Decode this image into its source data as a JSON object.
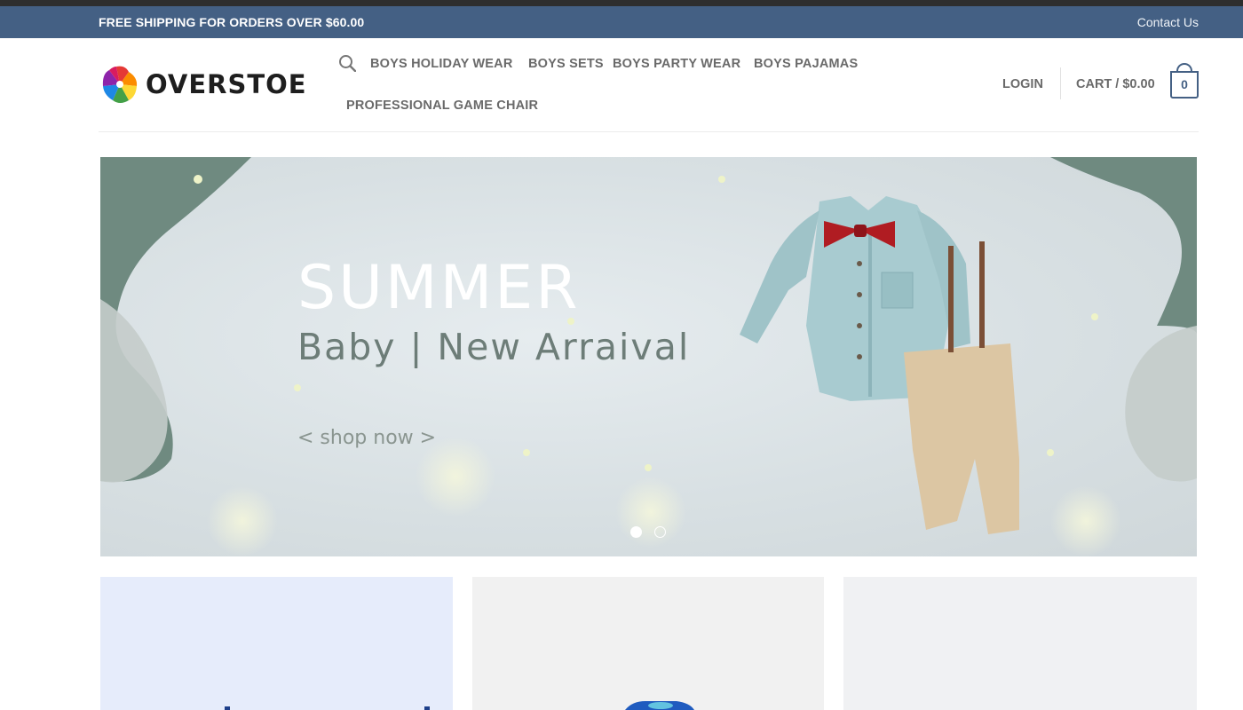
{
  "topbar": {
    "promo": "FREE SHIPPING FOR ORDERS OVER $60.00",
    "contact": "Contact Us"
  },
  "logo": {
    "text": "OVERSTOE"
  },
  "nav": {
    "items": [
      {
        "label": "BOYS HOLIDAY WEAR"
      },
      {
        "label": "BOYS SETS"
      },
      {
        "label": "BOYS PARTY WEAR"
      },
      {
        "label": "BOYS PAJAMAS"
      },
      {
        "label": "PROFESSIONAL GAME CHAIR"
      }
    ]
  },
  "account": {
    "login": "LOGIN",
    "cart": "CART / $0.00",
    "cart_count": "0"
  },
  "hero": {
    "title": "SUMMER",
    "subtitle": "Baby | New Arraival",
    "cta": "< shop now >",
    "slide_count": 2,
    "active_slide": 1
  },
  "colors": {
    "brand": "#446084",
    "nav_text": "#6a6a6a",
    "top_strip": "#2e2e2e"
  },
  "icons": [
    "search-icon",
    "cart-icon",
    "logo-pinwheel-icon"
  ]
}
